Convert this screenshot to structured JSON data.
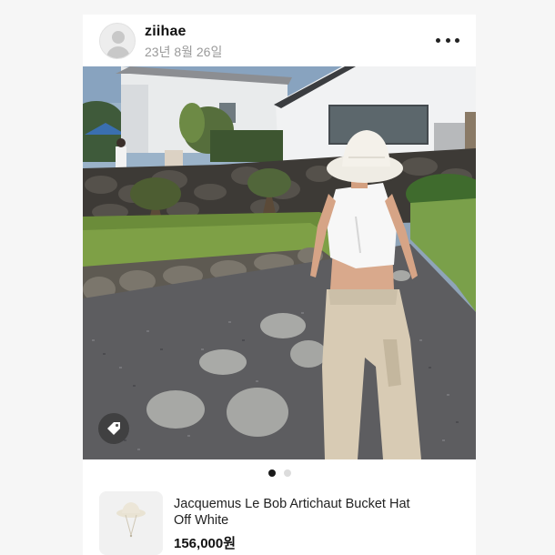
{
  "post": {
    "username": "ziihae",
    "date": "23년 8월 26일",
    "avatar_icon": "default-avatar-icon",
    "more_icon": "more-horizontal-icon",
    "photo_alt": "Person in white bucket hat and beige cargo pants standing on gravel garden path",
    "tag_icon": "price-tag-icon",
    "carousel": {
      "count": 2,
      "active_index": 0
    }
  },
  "product": {
    "name_line1": "Jacquemus Le Bob Artichaut Bucket Hat",
    "name_line2": "Off White",
    "price": "156,000원"
  },
  "colors": {
    "page_bg": "#f6f6f6",
    "card_bg": "#ffffff",
    "active_dot": "#1a1a1a",
    "inactive_dot": "#dcdcdc"
  }
}
